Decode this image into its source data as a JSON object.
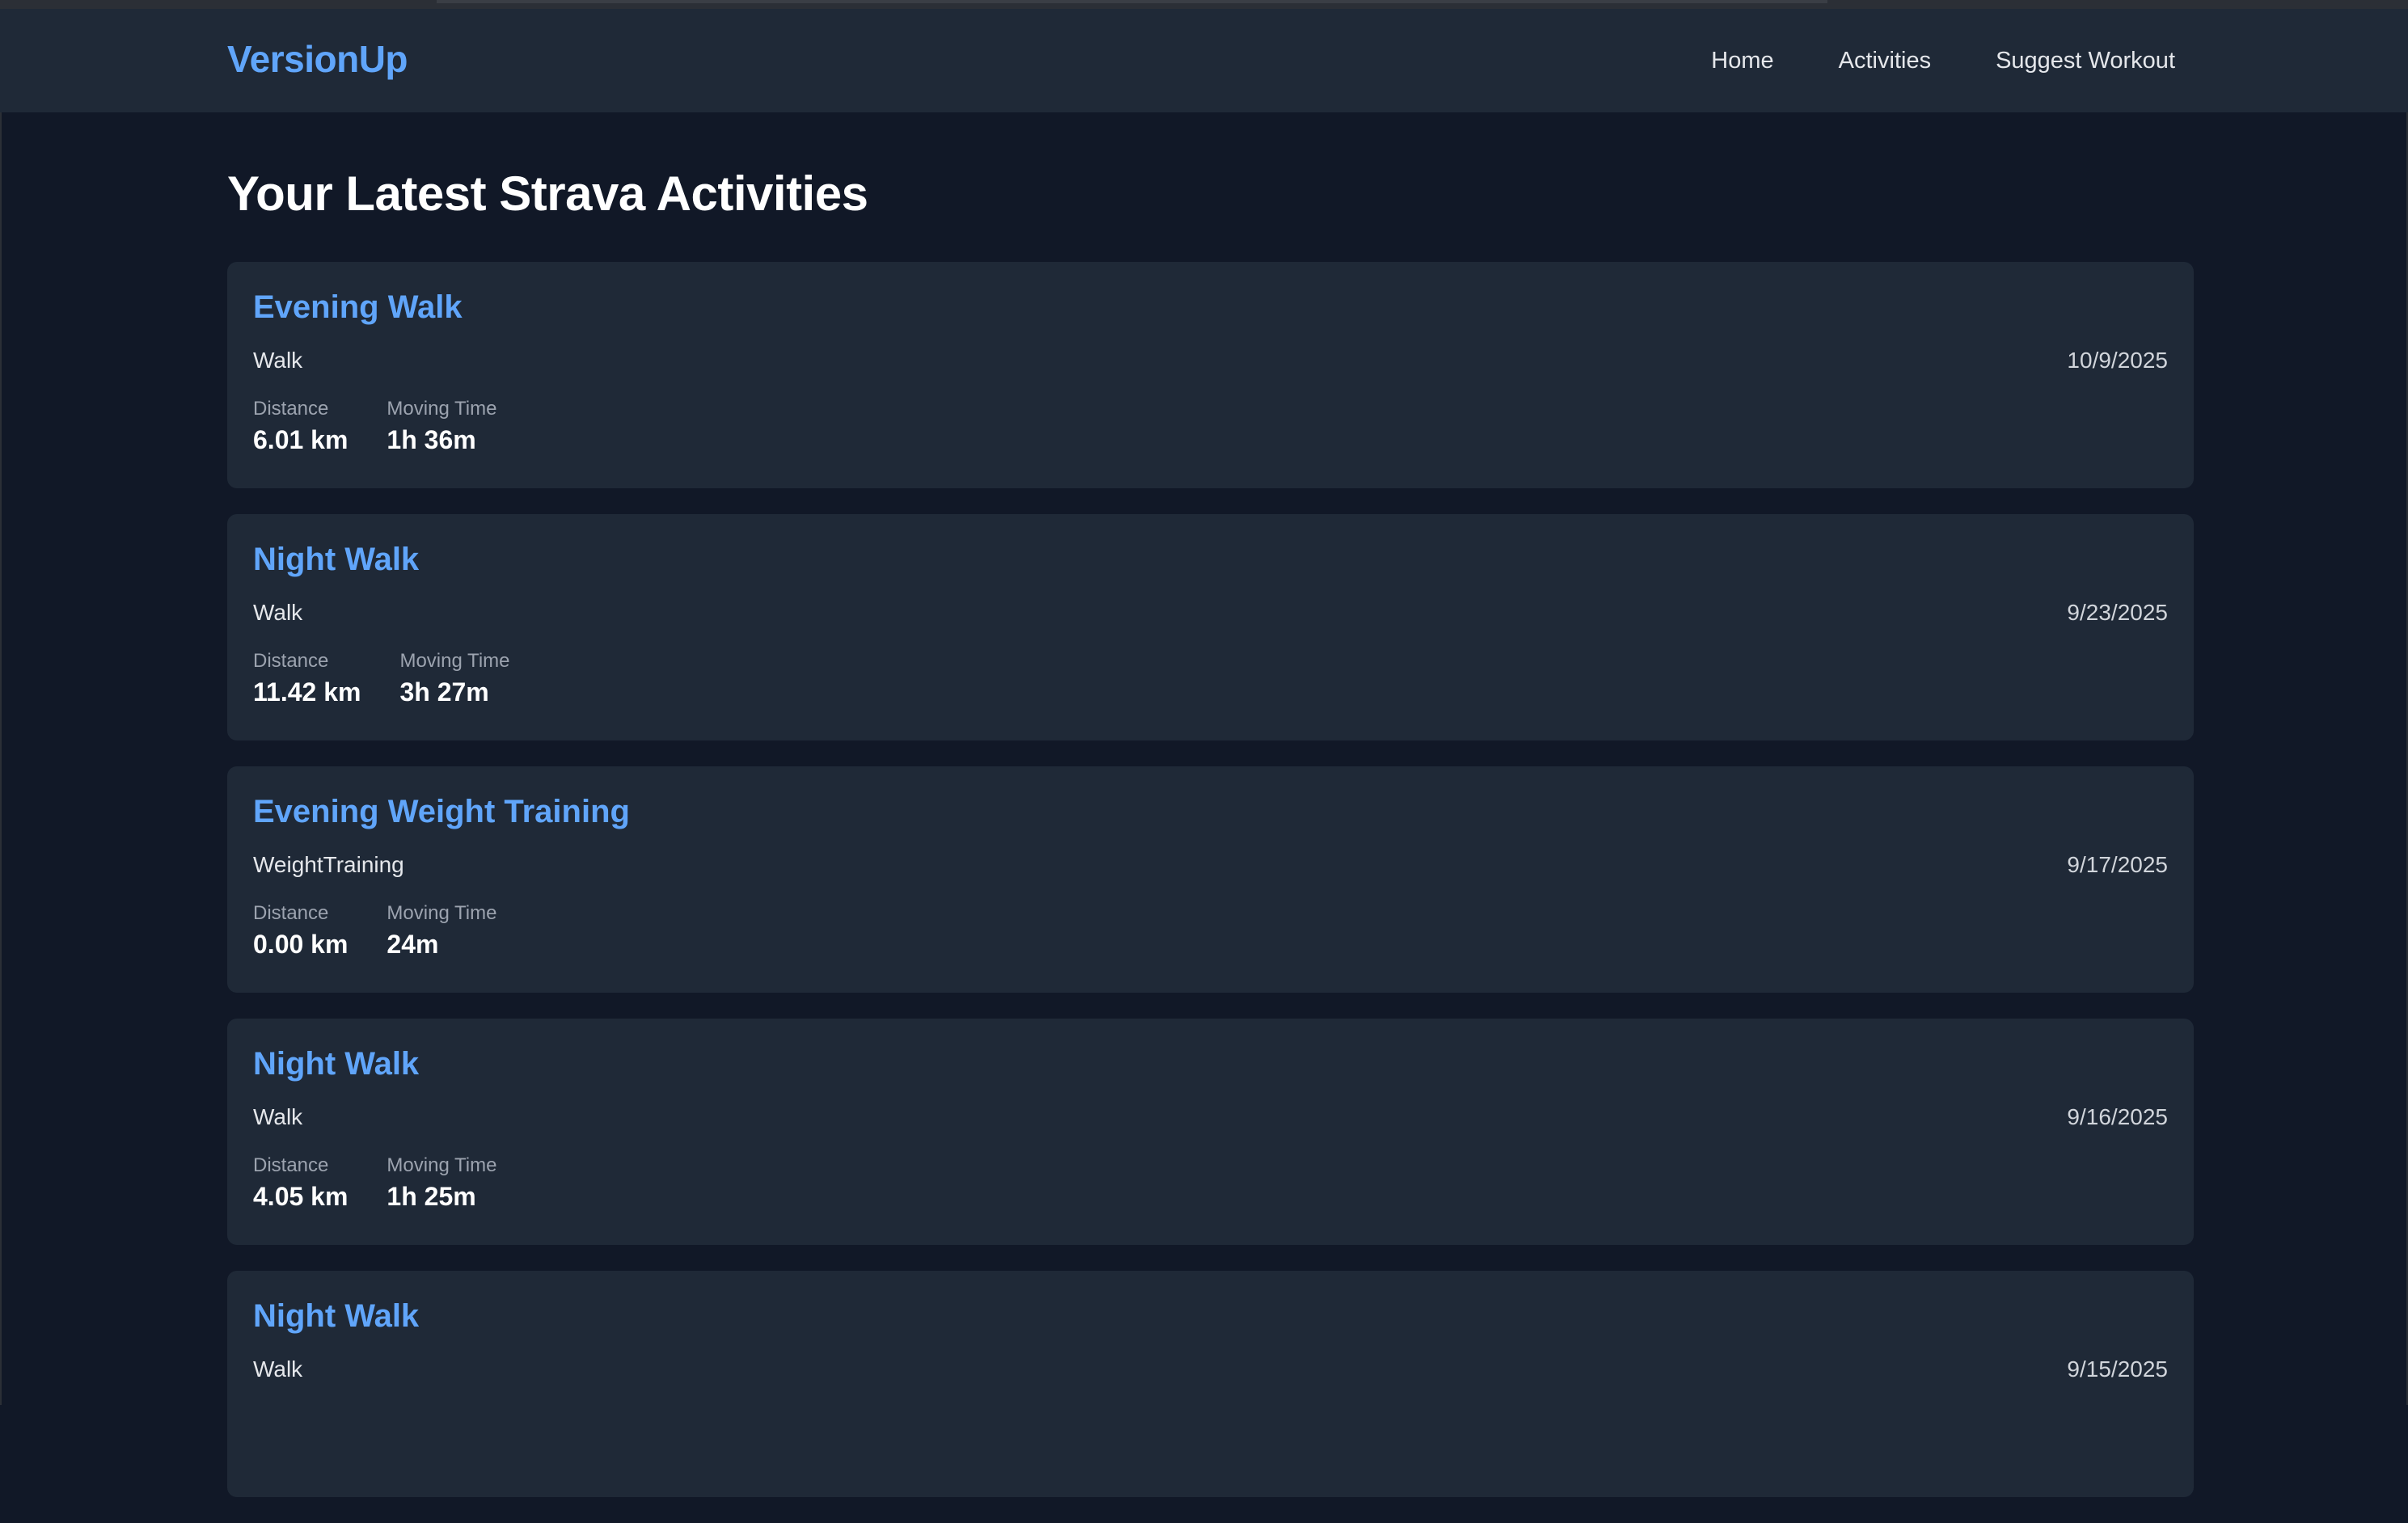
{
  "header": {
    "brand": "VersionUp",
    "nav": [
      {
        "label": "Home"
      },
      {
        "label": "Activities"
      },
      {
        "label": "Suggest Workout"
      }
    ]
  },
  "main": {
    "title": "Your Latest Strava Activities",
    "stat_labels": {
      "distance": "Distance",
      "moving_time": "Moving Time"
    },
    "activities": [
      {
        "name": "Evening Walk",
        "type": "Walk",
        "date": "10/9/2025",
        "distance": "6.01 km",
        "moving_time": "1h 36m"
      },
      {
        "name": "Night Walk",
        "type": "Walk",
        "date": "9/23/2025",
        "distance": "11.42 km",
        "moving_time": "3h 27m"
      },
      {
        "name": "Evening Weight Training",
        "type": "WeightTraining",
        "date": "9/17/2025",
        "distance": "0.00 km",
        "moving_time": "24m"
      },
      {
        "name": "Night Walk",
        "type": "Walk",
        "date": "9/16/2025",
        "distance": "4.05 km",
        "moving_time": "1h 25m"
      },
      {
        "name": "Night Walk",
        "type": "Walk",
        "date": "9/15/2025",
        "distance": "",
        "moving_time": ""
      }
    ]
  },
  "colors": {
    "background": "#111827",
    "surface": "#1f2937",
    "accent": "#60a5fa",
    "text": "#e5e7eb",
    "muted": "#9ca3af"
  }
}
